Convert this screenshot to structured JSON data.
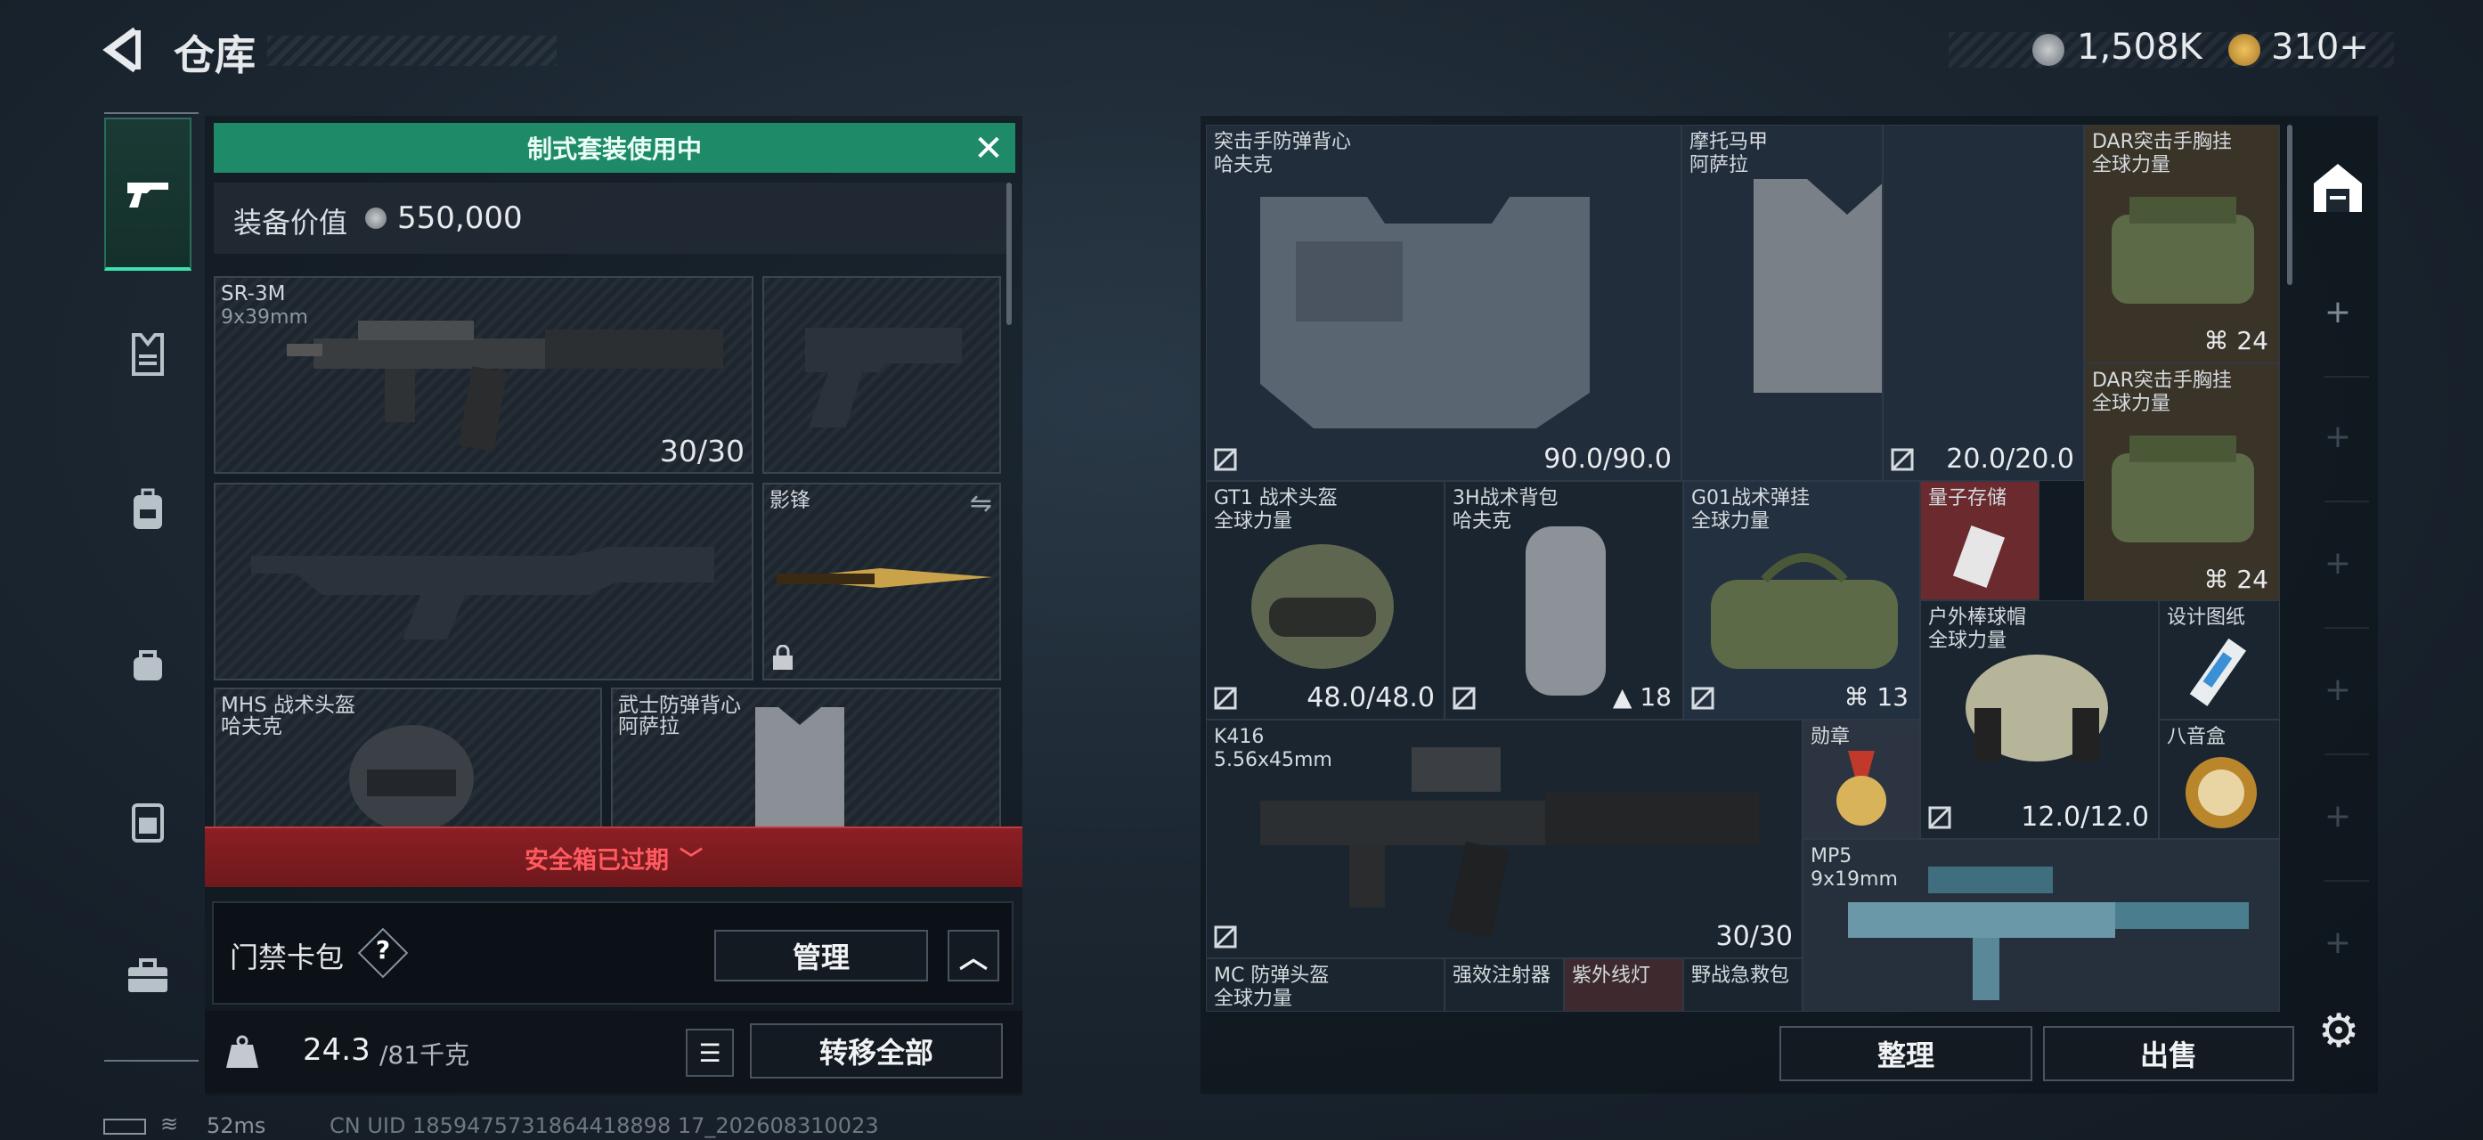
{
  "header": {
    "title": "仓库",
    "currency1": "1,508K",
    "currency2": "310+"
  },
  "loadout": {
    "banner": "制式套装使用中",
    "value_label": "装备价值",
    "value": "550,000",
    "primary": {
      "name": "SR-3M",
      "caliber": "9x39mm",
      "ammo": "30/30"
    },
    "melee": {
      "name": "影锋"
    },
    "helmet": {
      "name": "MHS 战术头盔",
      "brand": "哈夫克"
    },
    "armor": {
      "name": "武士防弹背心",
      "brand": "阿萨拉"
    },
    "secure_expired": "安全箱已过期",
    "keycard_label": "门禁卡包",
    "help": "?",
    "manage": "管理",
    "weight": "24.3",
    "weight_max": "/81千克",
    "transfer_all": "转移全部"
  },
  "storage": {
    "items": [
      {
        "name": "突击手防弹背心\n哈夫克",
        "value": "90.0/90.0"
      },
      {
        "name": "摩托马甲\n阿萨拉",
        "value": "20.0/20.0"
      },
      {
        "name": "DAR突击手胸挂\n全球力量",
        "value": "24"
      },
      {
        "name": "DAR突击手胸挂\n全球力量",
        "value": "24"
      },
      {
        "name": "GT1 战术头盔\n全球力量",
        "value": "48.0/48.0"
      },
      {
        "name": "3H战术背包\n哈夫克",
        "value": "18"
      },
      {
        "name": "G01战术弹挂\n全球力量",
        "value": "13"
      },
      {
        "name": "量子存储",
        "value": ""
      },
      {
        "name": "户外棒球帽\n全球力量",
        "value": "12.0/12.0"
      },
      {
        "name": "设计图纸",
        "value": ""
      },
      {
        "name": "K416\n5.56x45mm",
        "value": "30/30"
      },
      {
        "name": "勋章",
        "value": ""
      },
      {
        "name": "八音盒",
        "value": ""
      },
      {
        "name": "MP5\n9x19mm",
        "value": ""
      },
      {
        "name": "MC 防弹头盔\n全球力量",
        "value": ""
      },
      {
        "name": "强效注射器",
        "value": ""
      },
      {
        "name": "紫外线灯",
        "value": ""
      },
      {
        "name": "野战急救包",
        "value": ""
      }
    ],
    "sort": "整理",
    "sell": "出售"
  },
  "status": {
    "ping": "52ms",
    "uid": "CN UID 1859475731864418898 17_202608310023"
  },
  "colors": {
    "accent": "#3ee0b0",
    "banner": "#1f8a68",
    "danger": "#c33a3f"
  }
}
